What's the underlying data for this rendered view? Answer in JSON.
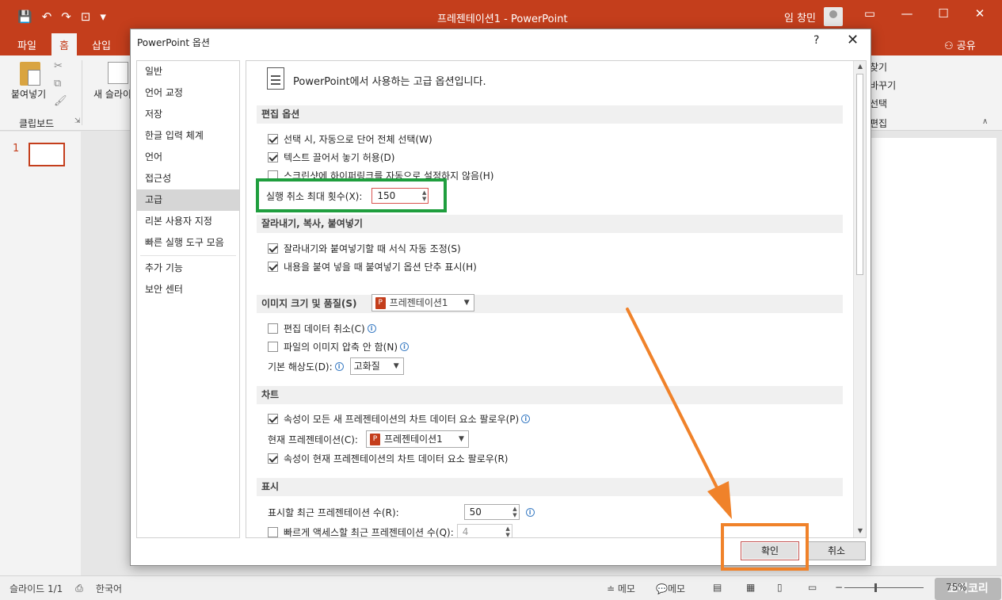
{
  "window": {
    "title": "프레젠테이션1  -  PowerPoint",
    "user": "임 창민",
    "qat": [
      "save-icon",
      "undo-icon",
      "redo-icon",
      "present-icon",
      "customize-icon"
    ],
    "controls": [
      "ribbon-display-icon",
      "minimize-icon",
      "maximize-icon",
      "close-icon"
    ]
  },
  "ribbon_tabs": [
    {
      "label": "파일",
      "active": false
    },
    {
      "label": "홈",
      "active": true
    },
    {
      "label": "삽입",
      "active": false
    }
  ],
  "share_label": "공유",
  "ribbon": {
    "paste_label": "붙여넣기",
    "clipboard_group": "클립보드",
    "new_slide_label": "새 슬라이",
    "find_label": "찾기",
    "replace_label": "바꾸기",
    "select_label": "선택",
    "editing_group": "편집"
  },
  "thumbnail_number": "1",
  "statusbar": {
    "slide_info": "슬라이드 1/1",
    "language": "한국어",
    "notes_label": "메모",
    "comments_label": "메모",
    "zoom": "75%"
  },
  "watermark_text": "코이코리",
  "dialog": {
    "title": "PowerPoint 옵션",
    "help": "?",
    "close": "✕",
    "nav_items": [
      {
        "label": "일반",
        "active": false
      },
      {
        "label": "언어 교정",
        "active": false
      },
      {
        "label": "저장",
        "active": false
      },
      {
        "label": "한글 입력 체계",
        "active": false
      },
      {
        "label": "언어",
        "active": false
      },
      {
        "label": "접근성",
        "active": false
      },
      {
        "label": "고급",
        "active": true
      },
      {
        "label": "리본 사용자 지정",
        "active": false
      },
      {
        "label": "빠른 실행 도구 모음",
        "active": false
      },
      {
        "label": "추가 기능",
        "active": false
      },
      {
        "label": "보안 센터",
        "active": false
      }
    ],
    "header_text": "PowerPoint에서 사용하는 고급 옵션입니다.",
    "sections": {
      "editing": "편집 옵션",
      "cut_copy_paste": "잘라내기, 복사, 붙여넣기",
      "image": "이미지 크기 및 품질(S)",
      "chart": "차트",
      "display": "표시"
    },
    "editing_options": [
      {
        "label": "선택 시, 자동으로 단어 전체 선택(W)",
        "checked": true
      },
      {
        "label": "텍스트 끌어서 놓기 허용(D)",
        "checked": true
      },
      {
        "label": "스크린샷에 하이퍼링크를 자동으로 설정하지 않음(H)",
        "checked": false
      }
    ],
    "undo_label": "실행 취소 최대 횟수(X):",
    "undo_value": "150",
    "paste_options": [
      {
        "label": "잘라내기와 붙여넣기할 때 서식 자동 조정(S)",
        "checked": true
      },
      {
        "label": "내용을 붙여 넣을 때 붙여넣기 옵션 단추 표시(H)",
        "checked": true
      }
    ],
    "image_presentation": "프레젠테이션1",
    "image_options": [
      {
        "label": "편집 데이터 취소(C)",
        "checked": false
      },
      {
        "label": "파일의 이미지 압축 안 함(N)",
        "checked": false
      }
    ],
    "default_resolution_label": "기본 해상도(D):",
    "default_resolution_value": "고화질",
    "chart_option_1": "속성이 모든 새 프레젠테이션의 차트 데이터 요소 팔로우(P)",
    "current_presentation_label": "현재 프레젠테이션(C):",
    "current_presentation_value": "프레젠테이션1",
    "chart_option_2": "속성이 현재 프레젠테이션의 차트 데이터 요소 팔로우(R)",
    "recent_count_label": "표시할 최근 프레젠테이션 수(R):",
    "recent_count_value": "50",
    "quick_access_label": "빠르게 액세스할 최근 프레젠테이션 수(Q):",
    "quick_access_value": "4",
    "ok_label": "확인",
    "cancel_label": "취소"
  },
  "colors": {
    "brand": "#c43e1c",
    "annotation_green": "#1f9e3e",
    "annotation_orange": "#f0822a"
  }
}
